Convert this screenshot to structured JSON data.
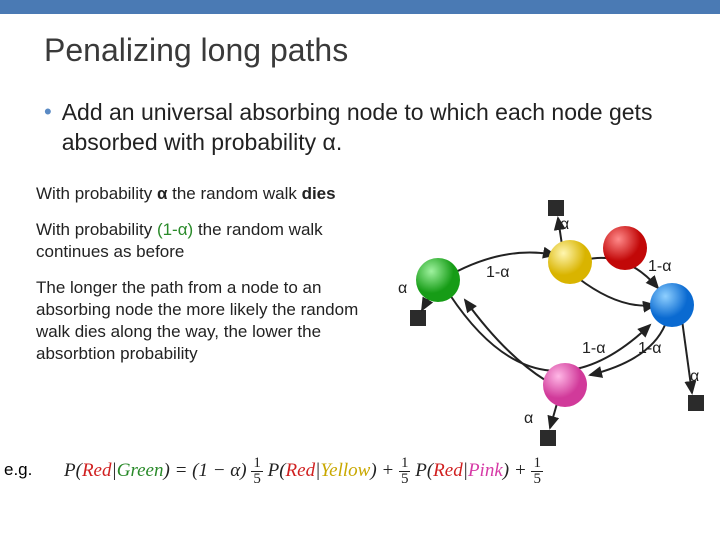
{
  "title": "Penalizing long paths",
  "bullet": "Add an universal absorbing node to which each node gets absorbed with probability α.",
  "para1_a": "With probability ",
  "para1_b": "α",
  "para1_c": " the random walk ",
  "para1_d": "dies",
  "para2_a": "With probability ",
  "para2_b": "(1-α)",
  "para2_c": " the random walk continues as before",
  "para3_a": "The longer the path",
  "para3_b": " from a node to an absorbing node the more likely the random walk dies along the way, ",
  "para3_c": "the lower the absorbtion probability",
  "eg": "e.g.",
  "formula": {
    "P": "P",
    "Red": "Red",
    "Green": "Green",
    "Yellow": "Yellow",
    "Pink": "Pink",
    "lp": "(",
    "rp": ")",
    "bar": "|",
    "eq": " = ",
    "one_minus_alpha": "(1 − α)",
    "frac_num": "1",
    "frac_den": "5",
    "plus": " + "
  },
  "labels": {
    "alpha": "α",
    "one_minus_alpha": "1-α"
  },
  "chart_data": {
    "type": "diagram",
    "description": "Graph with 5 circular colored nodes (green, yellow, red, pink, blue) connected by 1-α edges forming a cycle and some chords; each node has an edge to a dark square absorbing node labeled α.",
    "nodes": [
      {
        "id": "green",
        "color": "#2aa82a"
      },
      {
        "id": "yellow",
        "color": "#f2d31b"
      },
      {
        "id": "red",
        "color": "#e51b1b"
      },
      {
        "id": "pink",
        "color": "#e85fb9"
      },
      {
        "id": "blue",
        "color": "#1b7fe5"
      }
    ],
    "absorbing_node": {
      "shape": "square",
      "color": "#2b2b2b"
    },
    "transition_edges_label": "1-α",
    "absorbing_edges_label": "α"
  }
}
